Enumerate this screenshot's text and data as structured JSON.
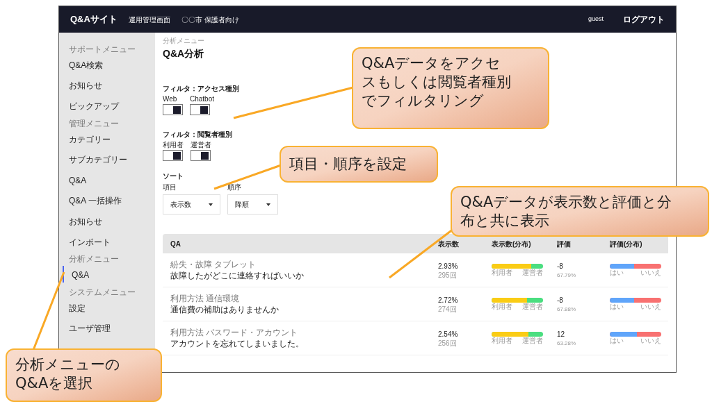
{
  "header": {
    "logo": "Q&Aサイト",
    "links": [
      "運用管理画面",
      "〇〇市 保護者向け"
    ],
    "user": "guest",
    "logout": "ログアウト"
  },
  "sidebar": [
    {
      "kind": "section",
      "label": "サポートメニュー"
    },
    {
      "kind": "item",
      "label": "Q&A検索",
      "selected": false
    },
    {
      "kind": "item",
      "label": "お知らせ",
      "selected": false
    },
    {
      "kind": "item",
      "label": "ピックアップ",
      "selected": false
    },
    {
      "kind": "section",
      "label": "管理メニュー"
    },
    {
      "kind": "item",
      "label": "カテゴリー",
      "selected": false
    },
    {
      "kind": "item",
      "label": "サブカテゴリー",
      "selected": false
    },
    {
      "kind": "item",
      "label": "Q&A",
      "selected": false
    },
    {
      "kind": "item",
      "label": "Q&A 一括操作",
      "selected": false
    },
    {
      "kind": "item",
      "label": "お知らせ",
      "selected": false
    },
    {
      "kind": "item",
      "label": "インポート",
      "selected": false
    },
    {
      "kind": "section",
      "label": "分析メニュー"
    },
    {
      "kind": "item",
      "label": "Q&A",
      "selected": true
    },
    {
      "kind": "section",
      "label": "システムメニュー"
    },
    {
      "kind": "item",
      "label": "設定",
      "selected": false
    },
    {
      "kind": "item",
      "label": "ユーザ管理",
      "selected": false
    }
  ],
  "breadcrumb": "分析メニュー",
  "title": "Q&A分析",
  "filters": [
    {
      "label": "フィルタ：アクセス種別",
      "toggles": [
        {
          "label": "Web",
          "on": true
        },
        {
          "label": "Chatbot",
          "on": true
        }
      ]
    },
    {
      "label": "フィルタ：閲覧者種別",
      "toggles": [
        {
          "label": "利用者",
          "on": true
        },
        {
          "label": "運営者",
          "on": true
        }
      ]
    }
  ],
  "sort": {
    "label": "ソート",
    "selects": [
      {
        "label": "項目",
        "value": "表示数"
      },
      {
        "label": "順序",
        "value": "降順"
      }
    ]
  },
  "table": {
    "columns": [
      "QA",
      "表示数",
      "表示数(分布)",
      "評価",
      "評価(分布)"
    ],
    "rows": [
      {
        "category": "紛失・故障 タブレット",
        "question": "故障したがどこに連絡すればいいか",
        "views": "2.93%",
        "count": "295回",
        "view_dist": {
          "level": 0.77,
          "left": "利用者",
          "right": "運営者"
        },
        "rating": "-8",
        "rating_pct": "67.79%",
        "rating_dist": {
          "level": 0.47,
          "left": "はい",
          "right": "いいえ"
        }
      },
      {
        "category": "利用方法 通信環境",
        "question": "通信費の補助はありませんか",
        "views": "2.72%",
        "count": "274回",
        "view_dist": {
          "level": 0.69,
          "left": "利用者",
          "right": "運営者"
        },
        "rating": "-8",
        "rating_pct": "67.88%",
        "rating_dist": {
          "level": 0.47,
          "left": "はい",
          "right": "いいえ"
        }
      },
      {
        "category": "利用方法 パスワード・アカウント",
        "question": "アカウントを忘れてしまいました。",
        "views": "2.54%",
        "count": "256回",
        "view_dist": {
          "level": 0.71,
          "left": "利用者",
          "right": "運営者"
        },
        "rating": "12",
        "rating_pct": "63.28%",
        "rating_dist": {
          "level": 0.53,
          "left": "はい",
          "right": "いいえ"
        }
      }
    ]
  },
  "callouts": [
    "Q&Aデータをアクセスもしくは閲覧者種別でフィルタリング",
    "項目・順序を設定",
    "Q&Aデータが表示数と評価と分布と共に表示",
    "分析メニューのQ&Aを選択"
  ]
}
